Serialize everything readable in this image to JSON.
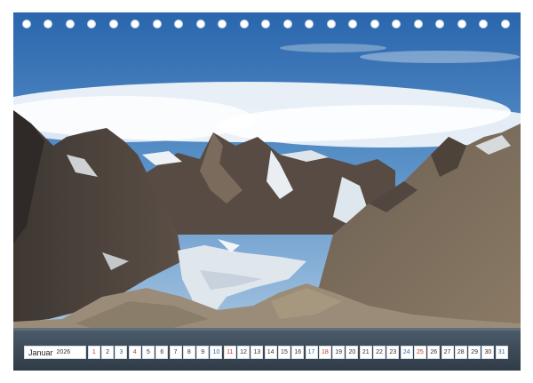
{
  "calendar": {
    "month": "Januar",
    "year": "2026",
    "days": [
      {
        "n": "1",
        "kind": "sun"
      },
      {
        "n": "2",
        "kind": "wd"
      },
      {
        "n": "3",
        "kind": "sat"
      },
      {
        "n": "4",
        "kind": "sun"
      },
      {
        "n": "5",
        "kind": "wd"
      },
      {
        "n": "6",
        "kind": "wd"
      },
      {
        "n": "7",
        "kind": "wd"
      },
      {
        "n": "8",
        "kind": "wd"
      },
      {
        "n": "9",
        "kind": "wd"
      },
      {
        "n": "10",
        "kind": "sat"
      },
      {
        "n": "11",
        "kind": "sun"
      },
      {
        "n": "12",
        "kind": "wd"
      },
      {
        "n": "13",
        "kind": "wd"
      },
      {
        "n": "14",
        "kind": "wd"
      },
      {
        "n": "15",
        "kind": "wd"
      },
      {
        "n": "16",
        "kind": "wd"
      },
      {
        "n": "17",
        "kind": "sat"
      },
      {
        "n": "18",
        "kind": "sun"
      },
      {
        "n": "19",
        "kind": "wd"
      },
      {
        "n": "20",
        "kind": "wd"
      },
      {
        "n": "21",
        "kind": "wd"
      },
      {
        "n": "22",
        "kind": "wd"
      },
      {
        "n": "23",
        "kind": "wd"
      },
      {
        "n": "24",
        "kind": "sat"
      },
      {
        "n": "25",
        "kind": "sun"
      },
      {
        "n": "26",
        "kind": "wd"
      },
      {
        "n": "27",
        "kind": "wd"
      },
      {
        "n": "28",
        "kind": "wd"
      },
      {
        "n": "29",
        "kind": "wd"
      },
      {
        "n": "30",
        "kind": "wd"
      },
      {
        "n": "31",
        "kind": "sat"
      }
    ]
  },
  "colors": {
    "sunday": "#c0392b",
    "saturday": "#2e6fa3",
    "sky": "#2f6fb3",
    "water": "#3d4c5a"
  }
}
